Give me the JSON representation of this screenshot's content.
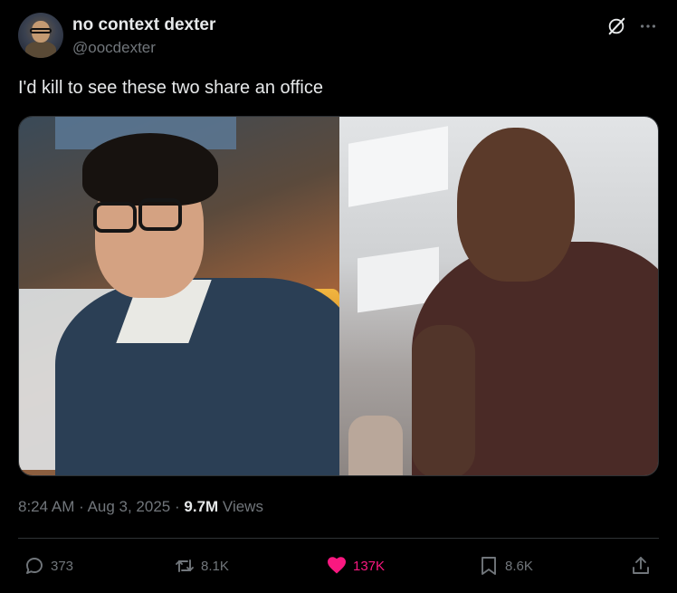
{
  "author": {
    "name": "no context dexter",
    "handle": "@oocdexter"
  },
  "tweet": {
    "text": "I'd kill to see these two share an office",
    "time": "8:24 AM",
    "date": "Aug 3, 2025",
    "views_count": "9.7M",
    "views_label": "Views"
  },
  "actions": {
    "replies": "373",
    "reposts": "8.1K",
    "likes": "137K",
    "bookmarks": "8.6K"
  },
  "icons": {
    "header": [
      "grok-icon",
      "more-icon"
    ],
    "actions": [
      "reply-icon",
      "repost-icon",
      "like-icon",
      "bookmark-icon",
      "share-icon"
    ]
  },
  "colors": {
    "background": "#000000",
    "text": "#e7e9ea",
    "secondary": "#71767b",
    "like": "#f91880",
    "divider": "#2f3336"
  }
}
